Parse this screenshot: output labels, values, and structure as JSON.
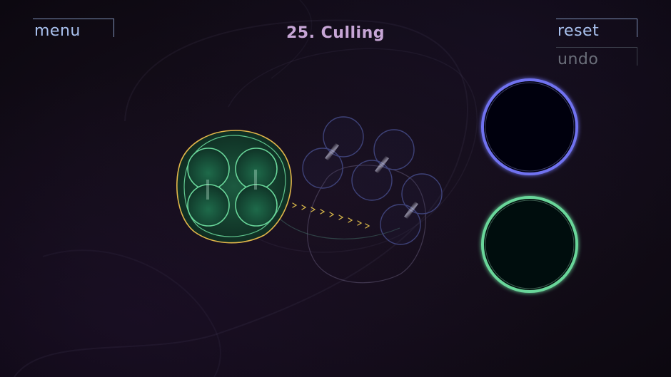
{
  "hud": {
    "menu_label": "menu",
    "reset_label": "reset",
    "undo_label": "undo",
    "level_title": "25. Culling"
  },
  "colors": {
    "title": "#c7a6d6",
    "button_text": "#a9c1ee",
    "button_disabled": "#6b6f7a",
    "player_cell": "#69d69a",
    "player_outline": "#e2b64a",
    "ghost_cell": "#4b4f8a",
    "arrow": "#d9b84a",
    "target_blue": "#6f72f0",
    "target_green": "#69d69a"
  },
  "icons": {
    "move_arrow": "chevron-right-icon"
  },
  "state": {
    "undo_enabled": false
  }
}
